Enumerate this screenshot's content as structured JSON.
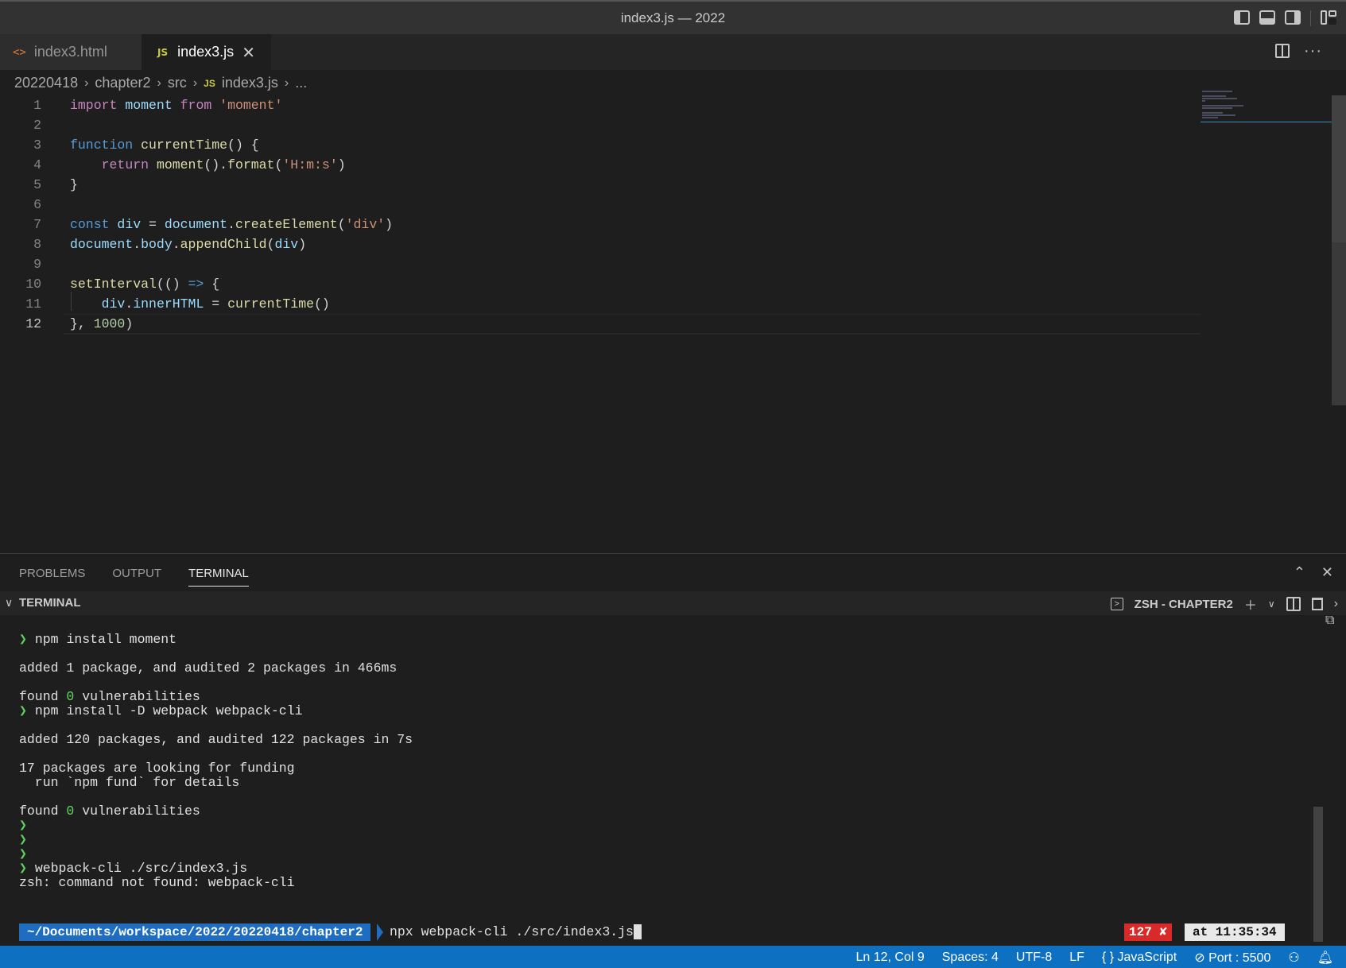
{
  "window": {
    "title": "index3.js — 2022"
  },
  "tabs": [
    {
      "label": "index3.html",
      "icon": "html-file-icon"
    },
    {
      "label": "index3.js",
      "icon": "js-file-icon",
      "icon_text": "JS",
      "close": "✕"
    }
  ],
  "breadcrumb": {
    "items": [
      "20220418",
      "chapter2",
      "src",
      "index3.js",
      "..."
    ],
    "js_badge": "JS"
  },
  "editor": {
    "current_line": 12,
    "line_numbers": [
      "1",
      "2",
      "3",
      "4",
      "5",
      "6",
      "7",
      "8",
      "9",
      "10",
      "11",
      "12"
    ],
    "code": {
      "l1": {
        "a": "import",
        "b": "moment",
        "c": "from",
        "d": "'moment'"
      },
      "l3": {
        "a": "function",
        "b": "currentTime",
        "c": "() {"
      },
      "l4": {
        "a": "return",
        "b": "moment",
        "c": "().",
        "d": "format",
        "e": "(",
        "f": "'H:m:s'",
        "g": ")"
      },
      "l5": {
        "a": "}"
      },
      "l7": {
        "a": "const",
        "b": "div",
        "c": "=",
        "d": "document",
        "e": ".",
        "f": "createElement",
        "g": "(",
        "h": "'div'",
        "i": ")"
      },
      "l8": {
        "a": "document",
        "b": ".",
        "c": "body",
        "d": ".",
        "e": "appendChild",
        "f": "(",
        "g": "div",
        "h": ")"
      },
      "l10": {
        "a": "setInterval",
        "b": "(() ",
        "c": "=>",
        "d": " {"
      },
      "l11": {
        "a": "div",
        "b": ".",
        "c": "innerHTML",
        "d": " = ",
        "e": "currentTime",
        "f": "()"
      },
      "l12": {
        "a": "}, ",
        "b": "1000",
        "c": ")"
      }
    }
  },
  "panel": {
    "tabs": [
      "PROBLEMS",
      "OUTPUT",
      "TERMINAL"
    ],
    "active_tab": "TERMINAL",
    "section_label": "TERMINAL",
    "shell_name": "ZSH - CHAPTER2"
  },
  "terminal": {
    "prompt_char": "❯",
    "lines": {
      "t1": "npm install moment",
      "t2": "added 1 package, and audited 2 packages in 466ms",
      "t3a": "found ",
      "t3b": "0",
      "t3c": " vulnerabilities",
      "t4": "npm install -D webpack webpack-cli",
      "t5": "added 120 packages, and audited 122 packages in 7s",
      "t6": "17 packages are looking for funding",
      "t7": "  run `npm fund` for details",
      "t8a": "found ",
      "t8b": "0",
      "t8c": " vulnerabilities",
      "t9": "webpack-cli ./src/index3.js",
      "t10": "zsh: command not found: webpack-cli"
    },
    "powerline": {
      "path": "~/Documents/workspace/2022/20220418/chapter2",
      "command": "npx webpack-cli ./src/index3.js",
      "exit_status": "127 ✘",
      "time": "at 11:35:34"
    }
  },
  "statusbar": {
    "position": "Ln 12, Col 9",
    "spaces": "Spaces: 4",
    "encoding": "UTF-8",
    "eol": "LF",
    "language": "JavaScript",
    "port": "Port : 5500"
  },
  "colors": {
    "statusbar": "#0e70c0",
    "powerline_path": "#1f6dc0",
    "error_segment": "#d92929",
    "prompt": "#5fd35f"
  }
}
